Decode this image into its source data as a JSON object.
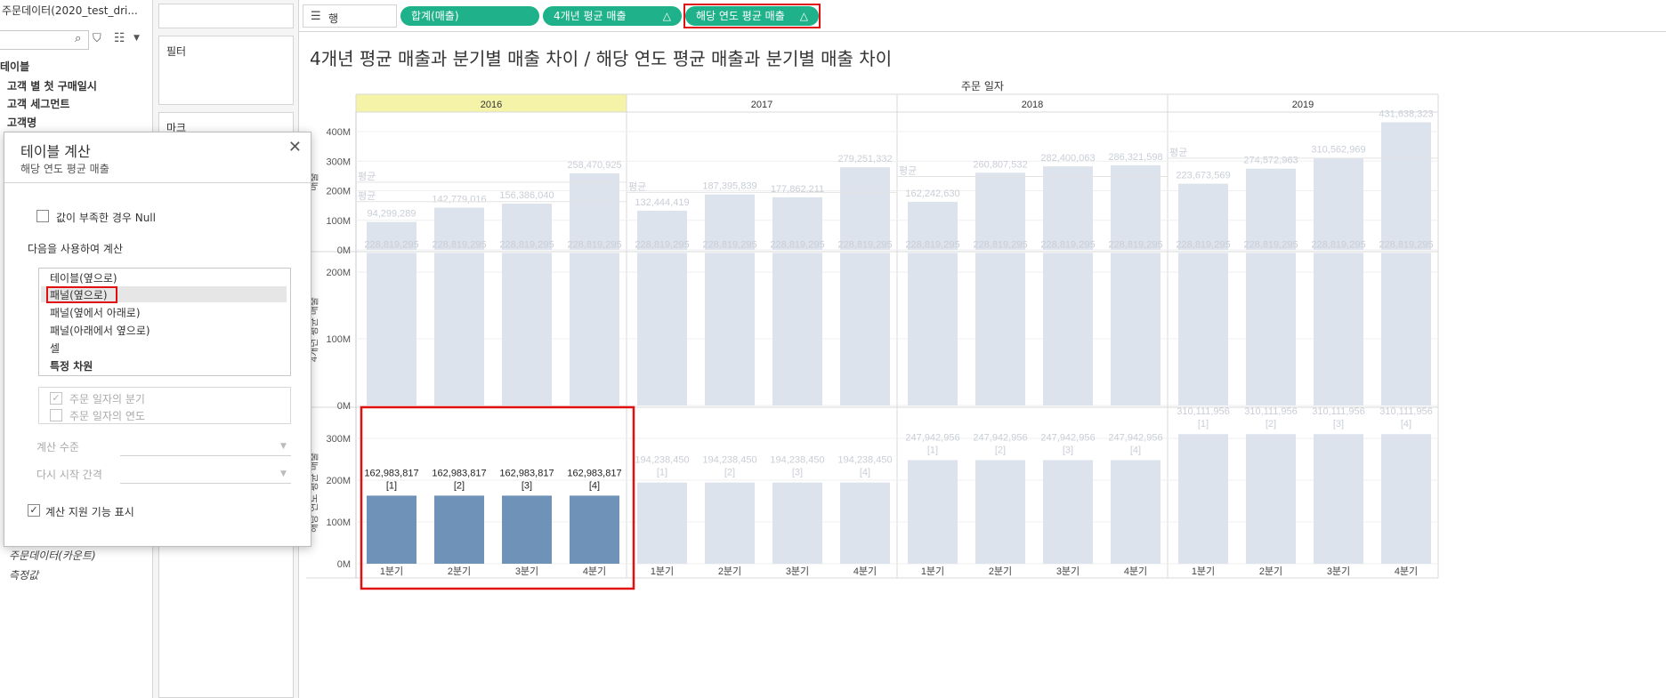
{
  "data_pane": {
    "datasource_title": "주문데이터(2020_test_dri...",
    "tables_label": "테이블",
    "fields": [
      "고객 별 첫 구매일시",
      "고객 세그먼트",
      "고객명"
    ],
    "measures": [
      "주문데이터(카운트)",
      "측정값"
    ]
  },
  "shelves": {
    "filter_label": "필터",
    "marks_label": "마크",
    "rows_label": "행",
    "pills": [
      {
        "label": "합계(매출)",
        "delta": ""
      },
      {
        "label": "4개년 평균 매출",
        "delta": "△"
      },
      {
        "label": "해당 연도 평균 매출",
        "delta": "△"
      }
    ]
  },
  "viz": {
    "title": "4개년 평균 매출과 분기별 매출 차이 / 해당 연도 평균 매출과 분기별 매출 차이",
    "column_header": "주문 일자"
  },
  "dialog": {
    "title": "테이블 계산",
    "subtitle": "해당 연도 평균 매출",
    "close_icon": "close-icon",
    "null_checkbox_label": "값이 부족한 경우 Null",
    "compute_using_label": "다음을 사용하여 계산",
    "compute_options": [
      "테이블(옆으로)",
      "패널(옆으로)",
      "패널(옆에서 아래로)",
      "패널(아래에서 옆으로)",
      "셀",
      "특정 차원"
    ],
    "selected_option_index": 1,
    "dimension_options": [
      "주문 일자의 분기",
      "주문 일자의 연도"
    ],
    "level_label": "계산 수준",
    "restart_label": "다시 시작 간격",
    "show_assistance_label": "계산 지원 기능 표시"
  },
  "chart_data": {
    "type": "bar",
    "years": [
      "2016",
      "2017",
      "2018",
      "2019"
    ],
    "highlighted_year": "2016",
    "quarters": [
      "1분기",
      "2분기",
      "3분기",
      "4분기"
    ],
    "avg_label": "평균",
    "colors": {
      "bar": "#dde3ec",
      "bar_highlight": "#6f93b8",
      "year_highlight": "#f5f3a8",
      "outline": "#e01010"
    },
    "panes": [
      {
        "axis_label": "매출",
        "ylim": [
          0,
          450000000
        ],
        "ticks": [
          {
            "v": 0,
            "label": "0M"
          },
          {
            "v": 100000000,
            "label": "100M"
          },
          {
            "v": 200000000,
            "label": "200M"
          },
          {
            "v": 300000000,
            "label": "300M"
          },
          {
            "v": 400000000,
            "label": "400M"
          }
        ],
        "values": [
          [
            94299289,
            142779016,
            156386040,
            258470925
          ],
          [
            132444419,
            187395839,
            177862211,
            279251332
          ],
          [
            162242630,
            260807532,
            282400063,
            286321598
          ],
          [
            223673569,
            274572963,
            310562969,
            431638323
          ]
        ],
        "labels": [
          [
            "94,299,289",
            "142,779,016",
            "156,386,040",
            "258,470,925"
          ],
          [
            "132,444,419",
            "187,395,839",
            "177,862,211",
            "279,251,332"
          ],
          [
            "162,242,630",
            "260,807,532",
            "282,400,063",
            "286,321,598"
          ],
          [
            "223,673,569",
            "274,572,963",
            "310,562,969",
            "431,638,323"
          ]
        ],
        "avg_lines": [
          [
            {
              "value": 228819295
            },
            {
              "value": 163000000
            }
          ],
          [
            {
              "value": 194238450
            }
          ],
          [
            {
              "value": 247942956
            }
          ],
          [
            {
              "value": 310111956
            }
          ]
        ]
      },
      {
        "axis_label": "4개년 평균 매출",
        "ylim": [
          0,
          250000000
        ],
        "ticks": [
          {
            "v": 0,
            "label": "0M"
          },
          {
            "v": 100000000,
            "label": "100M"
          },
          {
            "v": 200000000,
            "label": "200M"
          }
        ],
        "values": [
          [
            228819295,
            228819295,
            228819295,
            228819295
          ],
          [
            228819295,
            228819295,
            228819295,
            228819295
          ],
          [
            228819295,
            228819295,
            228819295,
            228819295
          ],
          [
            228819295,
            228819295,
            228819295,
            228819295
          ]
        ],
        "labels": [
          [
            "228,819,295",
            "228,819,295",
            "228,819,295",
            "228,819,295"
          ],
          [
            "228,819,295",
            "228,819,295",
            "228,819,295",
            "228,819,295"
          ],
          [
            "228,819,295",
            "228,819,295",
            "228,819,295",
            "228,819,295"
          ],
          [
            "228,819,295",
            "228,819,295",
            "228,819,295",
            "228,819,295"
          ]
        ]
      },
      {
        "axis_label": "해당 연도 평균 매출",
        "ylim": [
          0,
          350000000
        ],
        "ticks": [
          {
            "v": 0,
            "label": "0M"
          },
          {
            "v": 100000000,
            "label": "100M"
          },
          {
            "v": 200000000,
            "label": "200M"
          },
          {
            "v": 300000000,
            "label": "300M"
          }
        ],
        "values": [
          [
            162983817,
            162983817,
            162983817,
            162983817
          ],
          [
            194238450,
            194238450,
            194238450,
            194238450
          ],
          [
            247942956,
            247942956,
            247942956,
            247942956
          ],
          [
            310111956,
            310111956,
            310111956,
            310111956
          ]
        ],
        "labels": [
          [
            "162,983,817",
            "162,983,817",
            "162,983,817",
            "162,983,817"
          ],
          [
            "194,238,450",
            "194,238,450",
            "194,238,450",
            "194,238,450"
          ],
          [
            "247,942,956",
            "247,942,956",
            "247,942,956",
            "247,942,956"
          ],
          [
            "310,111,956",
            "310,111,956",
            "310,111,956",
            "310,111,956"
          ]
        ],
        "index_labels": [
          "[1]",
          "[2]",
          "[3]",
          "[4]"
        ]
      }
    ]
  }
}
